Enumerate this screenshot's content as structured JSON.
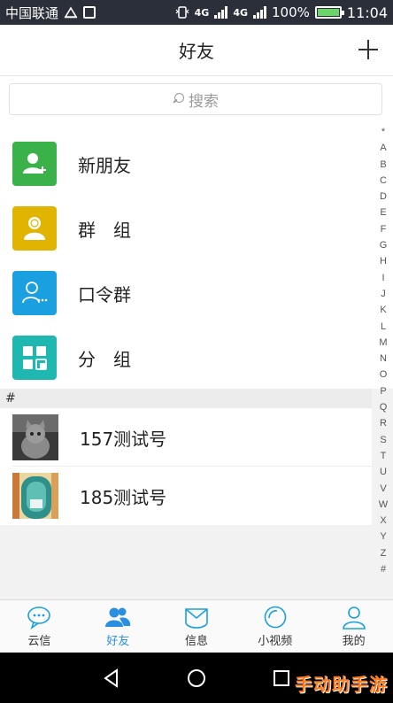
{
  "status_bar": {
    "carrier": "中国联通",
    "network_4g_a": "4G",
    "network_4g_b": "4G",
    "battery_percent": "100%",
    "battery_level": 1.0,
    "time": "11:04"
  },
  "header": {
    "title": "好友",
    "add_icon": "plus-icon"
  },
  "search": {
    "placeholder": "搜索"
  },
  "menu_items": [
    {
      "label": "新朋友",
      "color": "#3bb14a",
      "icon": "add-user-icon"
    },
    {
      "label": "群　组",
      "color": "#e0b400",
      "icon": "group-icon"
    },
    {
      "label": "口令群",
      "color": "#1a9fe0",
      "icon": "password-group-icon"
    },
    {
      "label": "分　组",
      "color": "#1fb8b0",
      "icon": "grid-icon"
    }
  ],
  "section": {
    "header": "#"
  },
  "contacts": [
    {
      "name": "157测试号",
      "avatar": "cat-photo"
    },
    {
      "name": "185测试号",
      "avatar": "door-photo"
    }
  ],
  "index_letters": [
    "*",
    "A",
    "B",
    "C",
    "D",
    "E",
    "F",
    "G",
    "H",
    "I",
    "J",
    "K",
    "L",
    "M",
    "N",
    "O",
    "P",
    "Q",
    "R",
    "S",
    "T",
    "U",
    "V",
    "W",
    "X",
    "Y",
    "Z",
    "#"
  ],
  "tabs": [
    {
      "label": "云信",
      "icon": "chat-bubble-icon",
      "active": false
    },
    {
      "label": "好友",
      "icon": "contacts-icon",
      "active": true
    },
    {
      "label": "信息",
      "icon": "mail-icon",
      "active": false
    },
    {
      "label": "小视频",
      "icon": "video-icon",
      "active": false
    },
    {
      "label": "我的",
      "icon": "profile-icon",
      "active": false
    }
  ],
  "colors": {
    "accent": "#2a8fe0",
    "status_bar_bg": "#2b2f3a"
  },
  "watermark": "手动助手游"
}
